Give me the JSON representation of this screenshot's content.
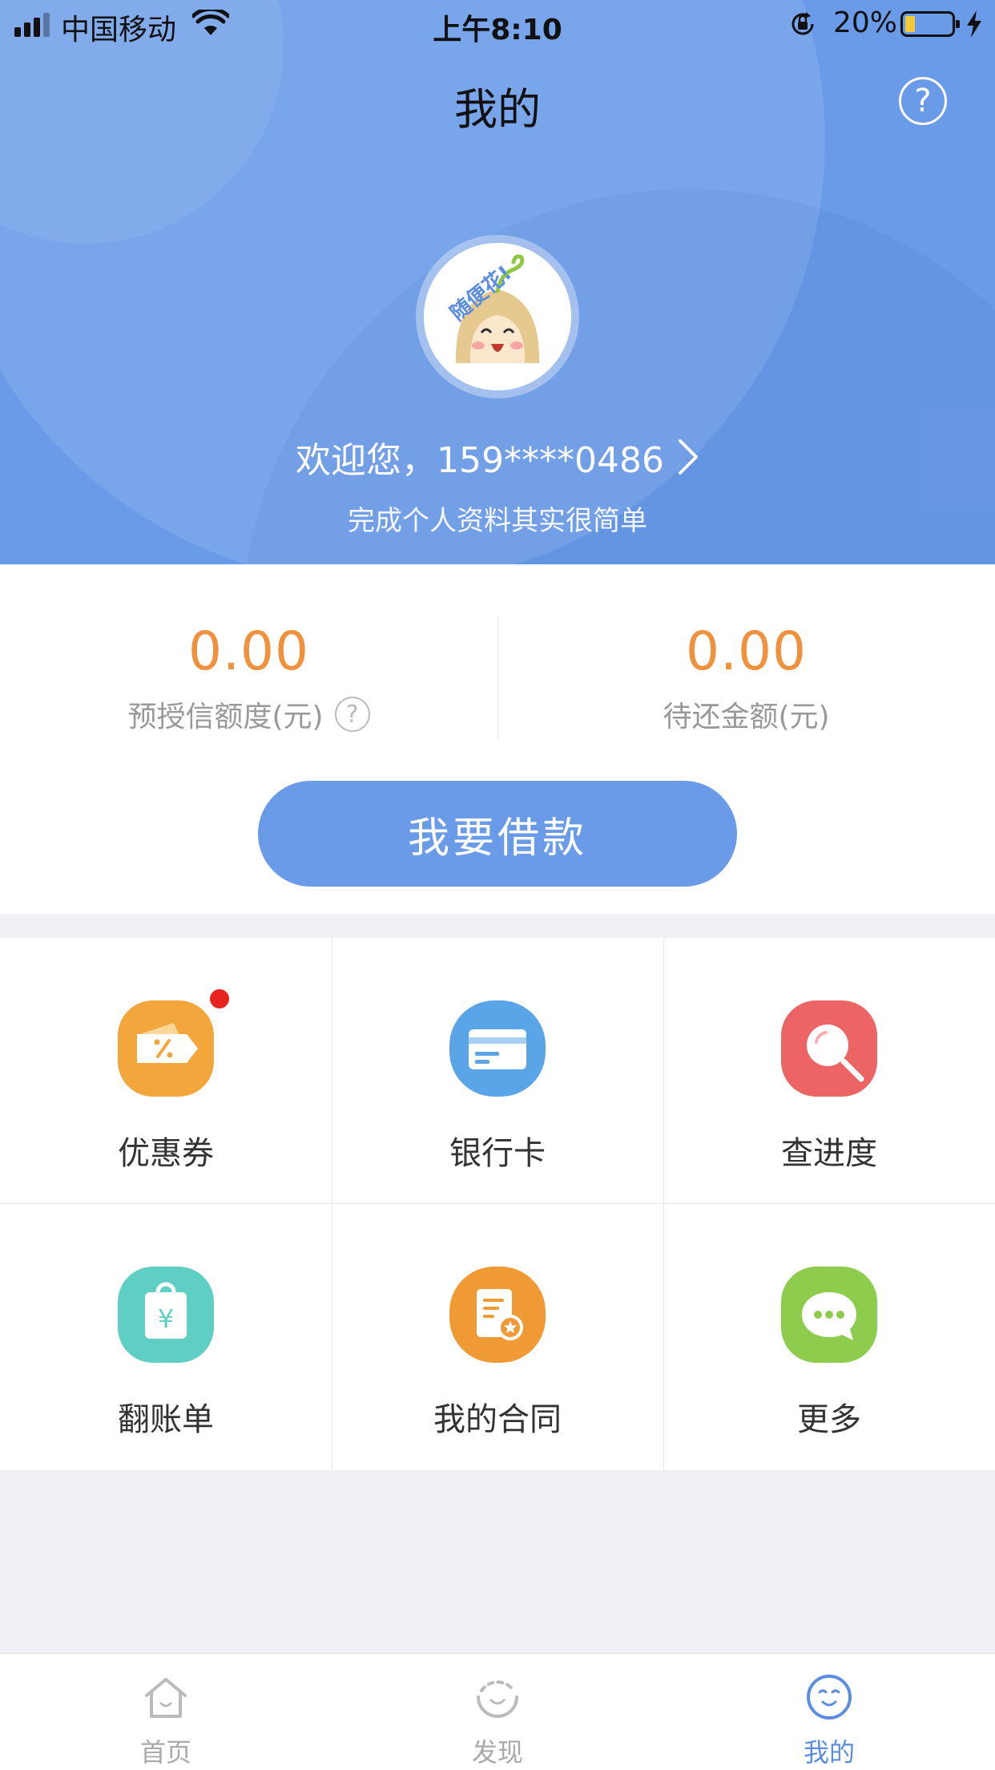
{
  "status_bar": {
    "carrier": "中国移动",
    "time": "上午8:10",
    "battery": "20%"
  },
  "nav": {
    "title": "我的",
    "help": "?"
  },
  "avatar": {
    "badge_text": "随便花!"
  },
  "profile": {
    "welcome": "欢迎您，159****0486",
    "hint": "完成个人资料其实很简单"
  },
  "stats": {
    "credit_value": "0.00",
    "credit_label": "预授信额度(元)",
    "repay_value": "0.00",
    "repay_label": "待还金额(元)"
  },
  "borrow_button": "我要借款",
  "grid": [
    {
      "label": "优惠券",
      "icon": "coupon-icon",
      "color": "#f3a63c"
    },
    {
      "label": "银行卡",
      "icon": "bank-card-icon",
      "color": "#5aa4e8"
    },
    {
      "label": "查进度",
      "icon": "search-progress-icon",
      "color": "#ec6464"
    },
    {
      "label": "翻账单",
      "icon": "bill-bag-icon",
      "color": "#5fcfc3"
    },
    {
      "label": "我的合同",
      "icon": "contract-icon",
      "color": "#f09a35"
    },
    {
      "label": "更多",
      "icon": "more-chat-icon",
      "color": "#8dcc4c"
    }
  ],
  "tabbar": [
    {
      "label": "首页",
      "icon": "home-icon"
    },
    {
      "label": "发现",
      "icon": "discover-icon"
    },
    {
      "label": "我的",
      "icon": "profile-icon",
      "active": true
    }
  ]
}
